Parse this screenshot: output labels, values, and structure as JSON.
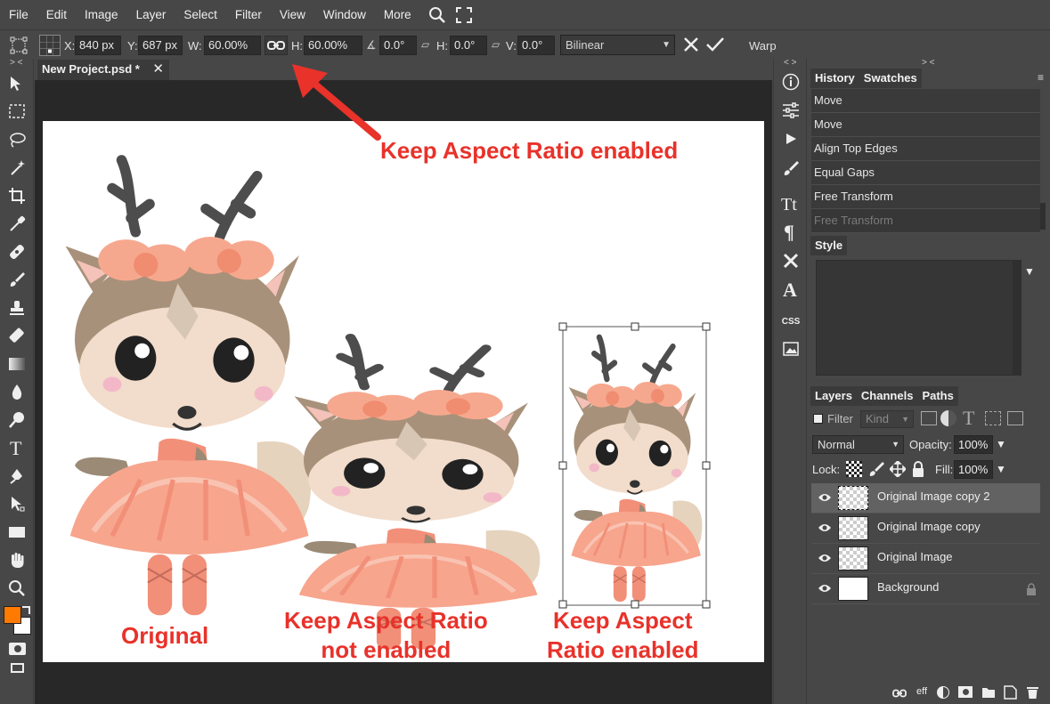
{
  "menu": {
    "items": [
      "File",
      "Edit",
      "Image",
      "Layer",
      "Select",
      "Filter",
      "View",
      "Window",
      "More"
    ]
  },
  "options": {
    "x_label": "X:",
    "x_value": "840 px",
    "y_label": "Y:",
    "y_value": "687 px",
    "w_label": "W:",
    "w_value": "60.00%",
    "h_label": "H:",
    "h_value": "60.00%",
    "angle_value": "0.0°",
    "skew_h_label": "H:",
    "skew_h_value": "0.0°",
    "skew_v_label": "V:",
    "skew_v_value": "0.0°",
    "interp": "Bilinear",
    "warp": "Warp"
  },
  "document": {
    "tab_title": "New Project.psd *",
    "tab_close": "✕"
  },
  "annotations": {
    "top": "Keep Aspect Ratio enabled",
    "original": "Original",
    "middle_line1": "Keep Aspect Ratio",
    "middle_line2": "not enabled",
    "right_line1": "Keep Aspect",
    "right_line2": "Ratio enabled"
  },
  "history": {
    "tabs": [
      "History",
      "Swatches"
    ],
    "items": [
      "Move",
      "Move",
      "Align Top Edges",
      "Equal Gaps",
      "Free Transform",
      "Free Transform"
    ]
  },
  "style": {
    "tab": "Style"
  },
  "layers": {
    "tabs": [
      "Layers",
      "Channels",
      "Paths"
    ],
    "filter_label": "Filter",
    "kind": "Kind",
    "blend_mode": "Normal",
    "opacity_label": "Opacity:",
    "opacity_value": "100%",
    "lock_label": "Lock:",
    "fill_label": "Fill:",
    "fill_value": "100%",
    "items": [
      "Original Image copy 2",
      "Original Image copy",
      "Original Image",
      "Background"
    ],
    "footer_eff": "eff"
  },
  "colors": {
    "foreground": "#ff7a00",
    "background": "#ffffff",
    "annotation": "#e8322a"
  }
}
